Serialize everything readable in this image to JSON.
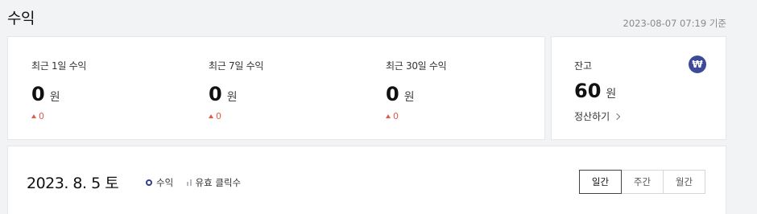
{
  "header": {
    "title": "수익",
    "timestamp": "2023-08-07 07:19 기준"
  },
  "revenue": {
    "items": [
      {
        "label": "최근 1일 수익",
        "value": "0",
        "unit": "원",
        "change": "0"
      },
      {
        "label": "최근 7일 수익",
        "value": "0",
        "unit": "원",
        "change": "0"
      },
      {
        "label": "최근 30일 수익",
        "value": "0",
        "unit": "원",
        "change": "0"
      }
    ]
  },
  "balance": {
    "label": "잔고",
    "icon_glyph": "₩",
    "value": "60",
    "unit": "원",
    "settle_label": "정산하기"
  },
  "chart": {
    "date": "2023. 8. 5 토",
    "legend": {
      "revenue": "수익",
      "clicks": "유효 클릭수"
    },
    "tabs": [
      "일간",
      "주간",
      "월간"
    ],
    "active_tab": "일간"
  },
  "colors": {
    "accent": "#3d4a9c",
    "increase": "#e35b4c"
  }
}
